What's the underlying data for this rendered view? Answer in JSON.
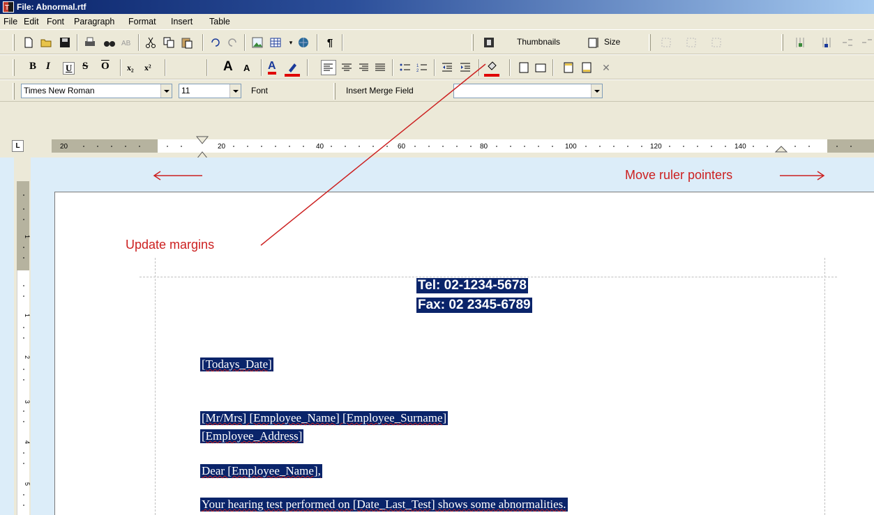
{
  "window": {
    "title": "File: Abnormal.rtf"
  },
  "menu": [
    "File",
    "Edit",
    "Font",
    "Paragraph",
    "Format",
    "Insert",
    "Table"
  ],
  "toolbar1": {
    "thumbnails_label": "Thumbnails",
    "size_label": "Size"
  },
  "toolbar2": {
    "bold": "B",
    "italic": "I",
    "underline": "U",
    "strike": "S",
    "overline": "O",
    "subscript": "x₂",
    "superscript": "x²",
    "grow": "A",
    "shrink": "A",
    "font_color": "A"
  },
  "toolbar3": {
    "font_name": "Times New Roman",
    "font_size": "11",
    "font_button": "Font",
    "merge_field_button": "Insert Merge Field",
    "merge_field_value": ""
  },
  "ruler": {
    "tab_selector": "L",
    "numbers": [
      "20",
      "20",
      "40",
      "60",
      "80",
      "100",
      "120",
      "140"
    ]
  },
  "annotations": {
    "move_ruler": "Move ruler pointers",
    "update_margins": "Update margins"
  },
  "document": {
    "tel": "Tel: 02-1234-5678",
    "fax": "Fax: 02 2345-6789",
    "date": "[Todays_Date]",
    "name_line": "[Mr/Mrs] [Employee_Name] [Employee_Surname]",
    "address": "[Employee_Address]",
    "greeting": "Dear [Employee_Name],",
    "body": "Your hearing test performed on [Date_Last_Test] shows some  abnormalities."
  },
  "vruler_numbers": [
    "1",
    "1",
    "2",
    "3",
    "4",
    "5"
  ],
  "colors": {
    "selection": "#0a246a",
    "annotation": "#cc2020",
    "doc_bg": "#dcedf9"
  }
}
